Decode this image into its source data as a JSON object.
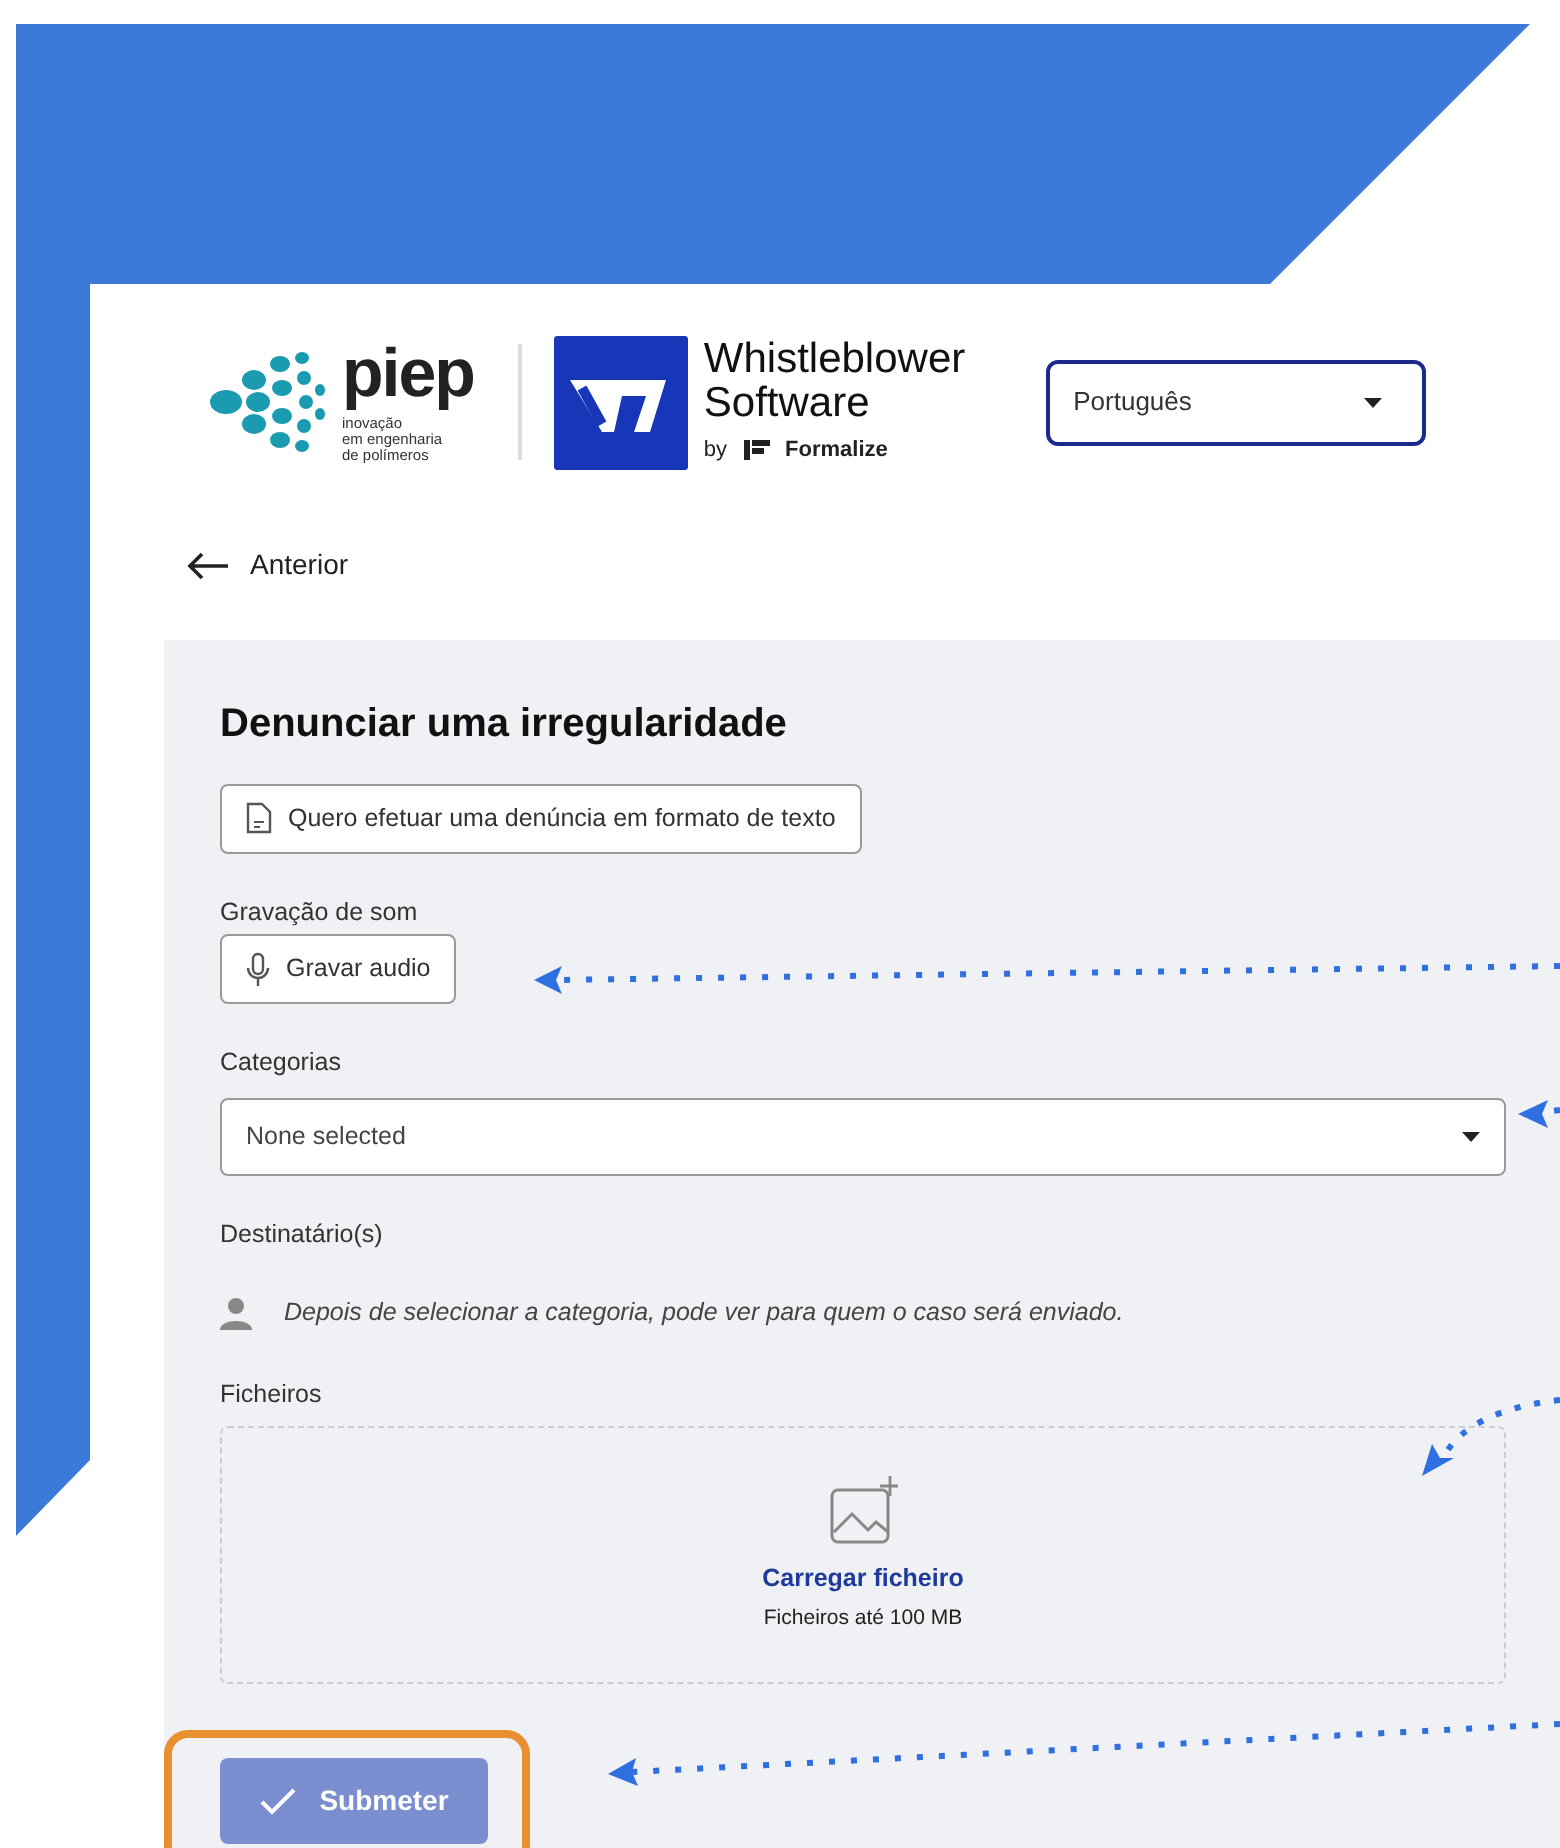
{
  "logo": {
    "name": "piep",
    "tagline": [
      "inovação",
      "em engenharia",
      "de polímeros"
    ]
  },
  "product": {
    "title_lines": [
      "Whistleblower",
      "Software"
    ],
    "by": "by",
    "brand": "Formalize"
  },
  "language": {
    "value": "Português"
  },
  "back": {
    "label": "Anterior"
  },
  "form": {
    "title": "Denunciar uma irregularidade",
    "text_report_button": "Quero efetuar uma denúncia em formato de texto",
    "audio": {
      "label": "Gravação de som",
      "button": "Gravar audio"
    },
    "categories": {
      "label": "Categorias",
      "value": "None selected"
    },
    "recipients": {
      "label": "Destinatário(s)",
      "note": "Depois de selecionar a categoria, pode ver para quem o caso será enviado."
    },
    "files": {
      "label": "Ficheiros",
      "link": "Carregar ficheiro",
      "hint": "Ficheiros até 100 MB"
    },
    "submit": {
      "label": "Submeter",
      "disabled": true,
      "highlighted": true
    }
  }
}
